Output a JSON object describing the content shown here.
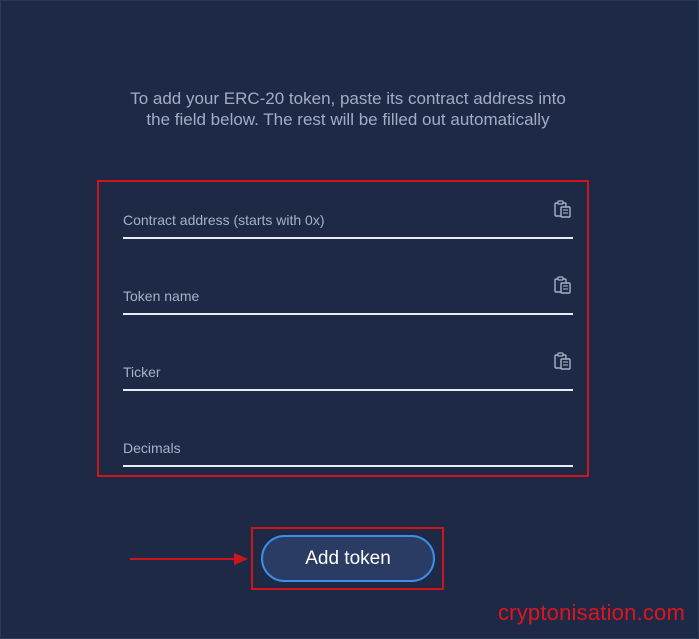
{
  "instructions": "To add your ERC-20 token, paste its contract address into the field below. The rest will be filled out automatically",
  "fields": {
    "contract": {
      "placeholder": "Contract address (starts with 0x)",
      "value": ""
    },
    "name": {
      "placeholder": "Token name",
      "value": ""
    },
    "ticker": {
      "placeholder": "Ticker",
      "value": ""
    },
    "decimals": {
      "placeholder": "Decimals",
      "value": ""
    }
  },
  "button": {
    "label": "Add token"
  },
  "watermark": "cryptonisation.com",
  "icons": {
    "paste": "clipboard-paste-icon",
    "arrow": "arrow-right-icon"
  },
  "colors": {
    "background": "#1e2a45",
    "highlight": "#d0141e",
    "button_border": "#3f8de8",
    "button_fill": "#2a3c63",
    "underline": "#e8ebf2"
  }
}
